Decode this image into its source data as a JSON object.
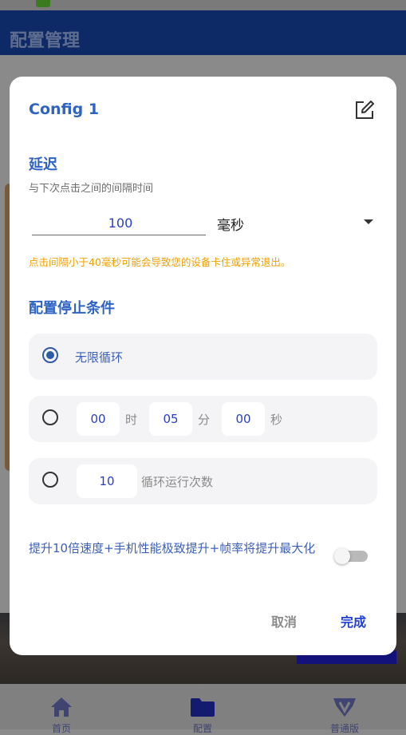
{
  "app": {
    "title": "配置管理"
  },
  "bottom_nav": [
    {
      "label": "首页",
      "icon": "home-icon"
    },
    {
      "label": "配置",
      "icon": "folder-icon"
    },
    {
      "label": "普通版",
      "icon": "vip-icon"
    }
  ],
  "dialog": {
    "title": "Config 1",
    "edit_icon": "edit-icon",
    "delay": {
      "title": "延迟",
      "hint": "与下次点击之间的间隔时间",
      "value": "100",
      "unit": "毫秒",
      "warning": "点击间隔小于40毫秒可能会导致您的设备卡住或异常退出。"
    },
    "stop": {
      "title": "配置停止条件",
      "infinite_label": "无限循环",
      "hours": "00",
      "hours_unit": "时",
      "minutes": "05",
      "minutes_unit": "分",
      "seconds": "00",
      "seconds_unit": "秒",
      "count": "10",
      "count_label": "循环运行次数",
      "selected": "infinite"
    },
    "boost": {
      "text": "提升10倍速度+手机性能极致提升+帧率将提升最大化",
      "enabled": false
    },
    "cancel_label": "取消",
    "done_label": "完成"
  },
  "colors": {
    "accent": "#2e63c4",
    "warning": "#f0a000",
    "primary_button": "#1f3fcf"
  }
}
